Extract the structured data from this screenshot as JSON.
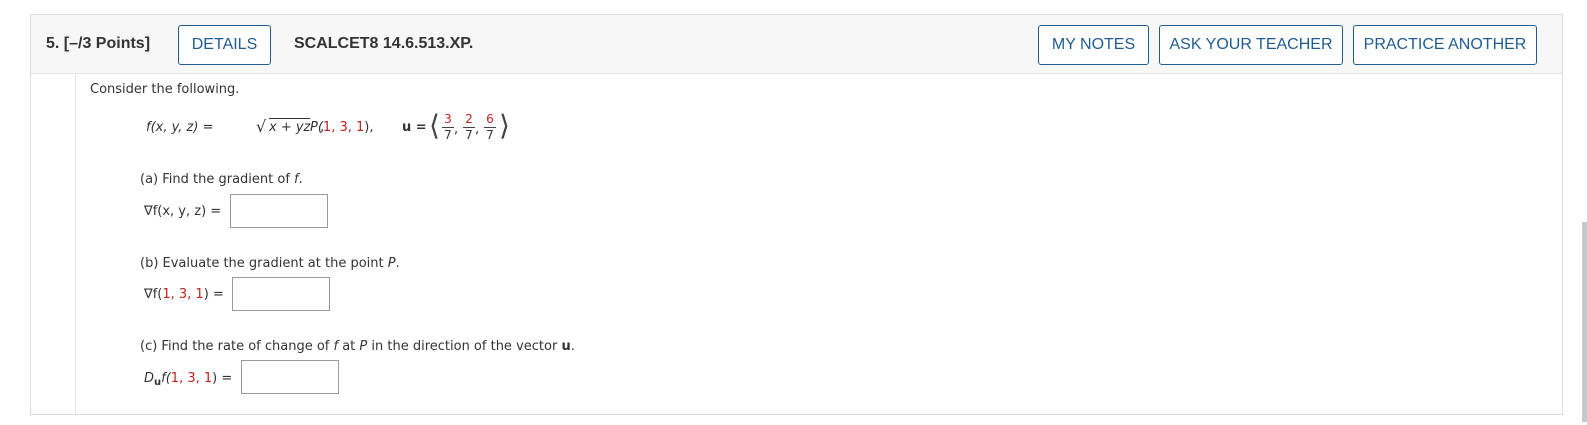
{
  "header": {
    "question_number": "5.  [–/3 Points]",
    "details_label": "DETAILS",
    "question_id": "SCALCET8 14.6.513.XP.",
    "my_notes_label": "MY NOTES",
    "ask_teacher_label": "ASK YOUR TEACHER",
    "practice_another_label": "PRACTICE ANOTHER"
  },
  "problem": {
    "intro": "Consider the following.",
    "func_lhs": "f(x, y, z) = ",
    "sqrt_sym": "√",
    "func_rad": "x + yz",
    "func_end": ",",
    "point_lhs": "P(",
    "point_vals": "1, 3, 1",
    "point_rhs": "),",
    "u_label": "u =",
    "u_open": "⟨",
    "u_close": "⟩",
    "u_num1": "3",
    "u_den1": "7",
    "u_num2": "2",
    "u_den2": "7",
    "u_num3": "6",
    "u_den3": "7",
    "comma": ","
  },
  "parts": {
    "a_prompt_pre": "(a) Find the gradient of ",
    "a_prompt_f": "f",
    "a_prompt_post": ".",
    "a_label": "∇f(x, y, z) =",
    "b_prompt_pre": "(b) Evaluate the gradient at the point ",
    "b_prompt_p": "P",
    "b_prompt_post": ".",
    "b_label_pre": "∇f(",
    "b_label_vals": "1, 3, 1",
    "b_label_post": ") =",
    "c_prompt_pre": "(c) Find the rate of change of ",
    "c_prompt_f": "f",
    "c_prompt_mid": " at ",
    "c_prompt_p": "P",
    "c_prompt_mid2": " in the direction of the vector ",
    "c_prompt_u": "u",
    "c_prompt_post": ".",
    "c_label_d": "D",
    "c_label_u": "u",
    "c_label_f": "f(",
    "c_label_vals": "1, 3, 1",
    "c_label_post": ") ="
  },
  "answers": {
    "a": "",
    "b": "",
    "c": ""
  }
}
